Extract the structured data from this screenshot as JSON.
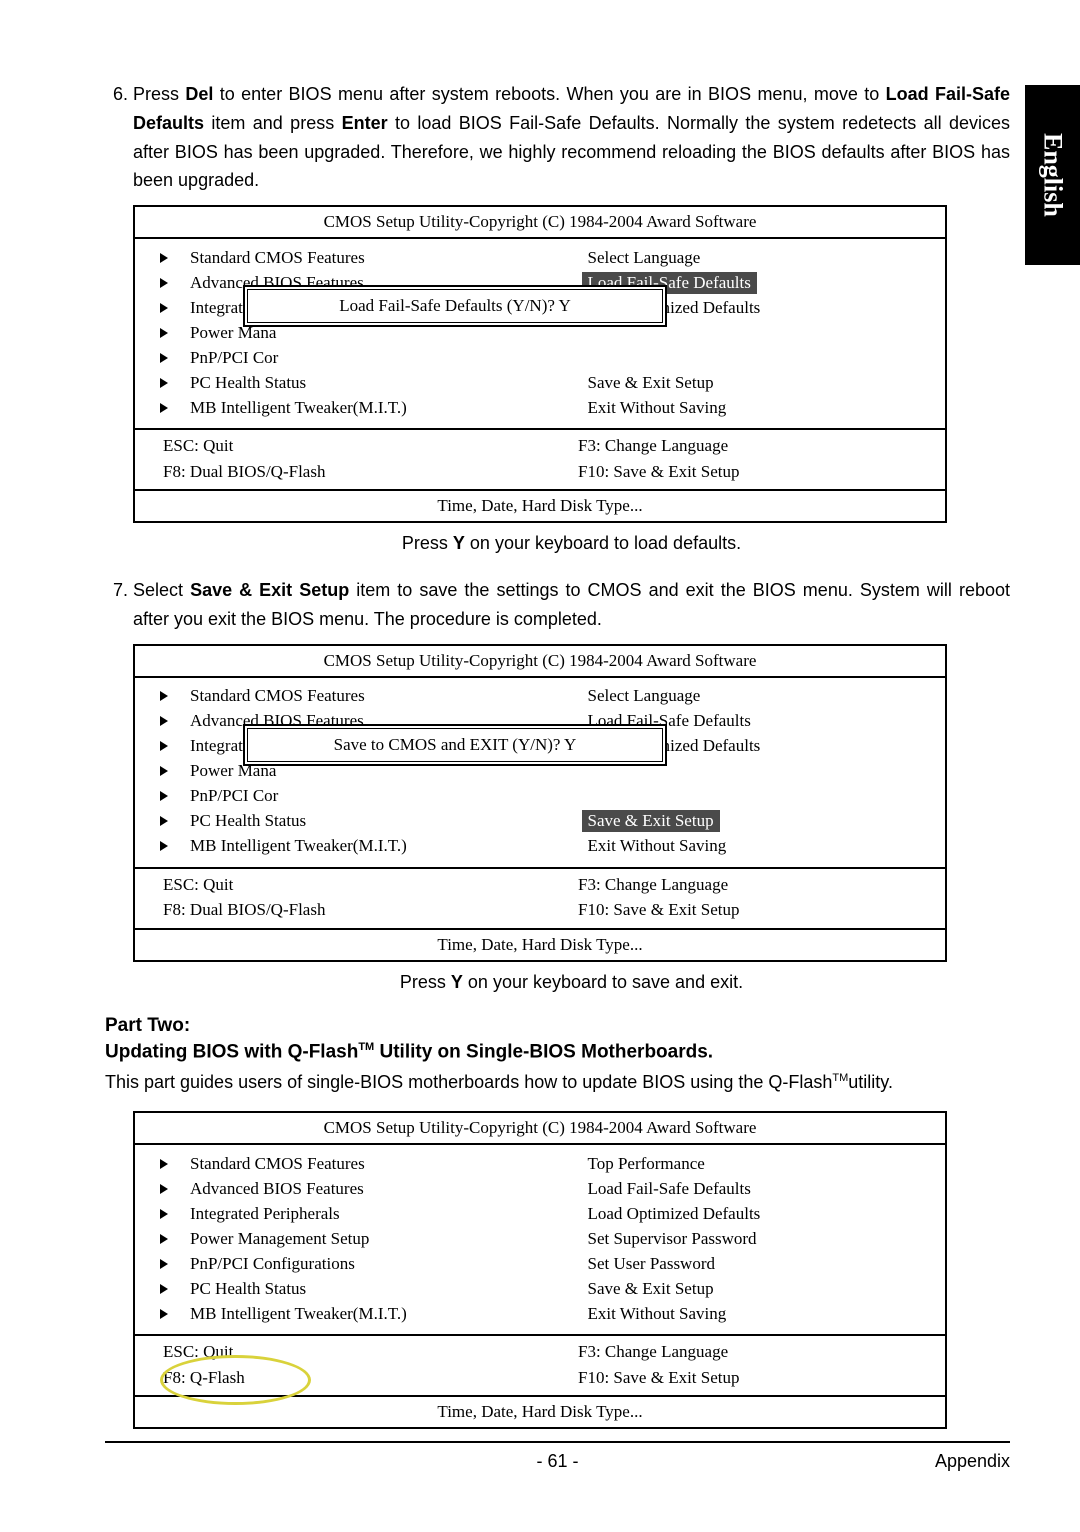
{
  "side_tab": "English",
  "step6": {
    "num": "6.",
    "t1": "Press ",
    "del": "Del",
    "t2": " to enter BIOS menu after system reboots. When you are in BIOS menu, move to ",
    "lfsd": "Load Fail-Safe Defaults",
    "t3": " item and press ",
    "enter": "Enter",
    "t4": " to load BIOS Fail-Safe Defaults. Normally the system redetects all devices after BIOS has been upgraded. Therefore, we highly recommend reloading the BIOS defaults after BIOS has been upgraded."
  },
  "bios_common": {
    "title": "CMOS Setup Utility-Copyright (C) 1984-2004 Award Software",
    "left": [
      "Standard CMOS Features",
      "Advanced BIOS Features",
      "Integrated Peripherals",
      "Power Mana",
      "PnP/PCI Cor",
      "PC Health Status",
      "MB Intelligent Tweaker(M.I.T.)"
    ],
    "left_full": [
      "Standard CMOS Features",
      "Advanced BIOS Features",
      "Integrated Peripherals",
      "Power Management Setup",
      "PnP/PCI Configurations",
      "PC Health Status",
      "MB Intelligent Tweaker(M.I.T.)"
    ],
    "right_a": [
      "Select Language",
      "Load Fail-Safe Defaults",
      "Load Optimized Defaults",
      "",
      "",
      "Save & Exit Setup",
      "Exit Without Saving"
    ],
    "right_c": [
      "Top Performance",
      "Load Fail-Safe Defaults",
      "Load Optimized Defaults",
      "Set Supervisor Password",
      "Set User Password",
      "Save & Exit Setup",
      "Exit Without Saving"
    ],
    "keys": {
      "esc": "ESC: Quit",
      "f8a": "F8: Dual BIOS/Q-Flash",
      "f8b": "F8: Q-Flash",
      "f3": "F3: Change Language",
      "f10": "F10: Save & Exit Setup"
    },
    "foot": "Time, Date, Hard Disk Type..."
  },
  "dialog1": "Load Fail-Safe Defaults (Y/N)? Y",
  "dialog2": "Save to CMOS and EXIT (Y/N)? Y",
  "caption1_a": "Press ",
  "caption1_b": "Y",
  "caption1_c": " on your keyboard to load defaults.",
  "step7": {
    "num": "7.",
    "t1": "Select ",
    "sae": "Save & Exit Setup",
    "t2": " item to save the settings to CMOS and exit the BIOS menu. System will reboot after you exit the BIOS menu. The procedure is completed."
  },
  "caption2_a": "Press ",
  "caption2_b": "Y",
  "caption2_c": " on your keyboard to save and exit.",
  "part2": {
    "head": "Part Two:",
    "sub_a": "Updating BIOS with Q-Flash",
    "sub_tm": "TM",
    "sub_b": " Utility on Single-BIOS Motherboards.",
    "body_a": "This part guides users of single-BIOS motherboards how to update BIOS using the Q-Flash",
    "body_tm": "TM",
    "body_b": "utility."
  },
  "footer": {
    "page": "- 61 -",
    "section": "Appendix"
  }
}
